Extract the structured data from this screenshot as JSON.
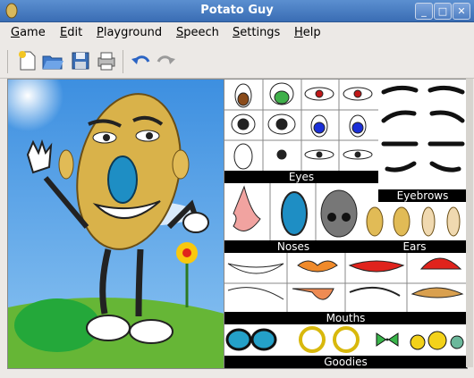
{
  "window": {
    "title": "Potato Guy"
  },
  "menu": [
    {
      "label": "Game",
      "u": "G",
      "rest": "ame"
    },
    {
      "label": "Edit",
      "u": "E",
      "rest": "dit"
    },
    {
      "label": "Playground",
      "u": "P",
      "rest": "layground"
    },
    {
      "label": "Speech",
      "u": "S",
      "rest": "peech"
    },
    {
      "label": "Settings",
      "u": "S",
      "rest": "ettings"
    },
    {
      "label": "Help",
      "u": "H",
      "rest": "elp"
    }
  ],
  "toolbar": [
    "new-icon",
    "open-icon",
    "save-icon",
    "print-icon",
    "undo-icon",
    "redo-icon"
  ],
  "palette": {
    "eyes": "Eyes",
    "eyebrows": "Eyebrows",
    "noses": "Noses",
    "ears": "Ears",
    "mouths": "Mouths",
    "goodies": "Goodies"
  },
  "colors": {
    "titlebar": "#4a7ec4",
    "sky": "#5aa0e6",
    "grass": "#6fbf3a"
  }
}
